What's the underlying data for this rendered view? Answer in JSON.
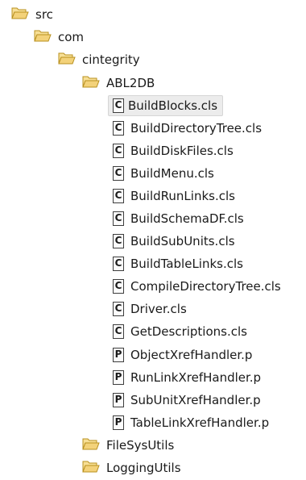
{
  "tree": {
    "src": "src",
    "com": "com",
    "cintegrity": "cintegrity",
    "abl2db": "ABL2DB",
    "files": [
      {
        "name": "BuildBlocks.cls",
        "type": "C"
      },
      {
        "name": "BuildDirectoryTree.cls",
        "type": "C"
      },
      {
        "name": "BuildDiskFiles.cls",
        "type": "C"
      },
      {
        "name": "BuildMenu.cls",
        "type": "C"
      },
      {
        "name": "BuildRunLinks.cls",
        "type": "C"
      },
      {
        "name": "BuildSchemaDF.cls",
        "type": "C"
      },
      {
        "name": "BuildSubUnits.cls",
        "type": "C"
      },
      {
        "name": "BuildTableLinks.cls",
        "type": "C"
      },
      {
        "name": "CompileDirectoryTree.cls",
        "type": "C"
      },
      {
        "name": "Driver.cls",
        "type": "C"
      },
      {
        "name": "GetDescriptions.cls",
        "type": "C"
      },
      {
        "name": "ObjectXrefHandler.p",
        "type": "P"
      },
      {
        "name": "RunLinkXrefHandler.p",
        "type": "P"
      },
      {
        "name": "SubUnitXrefHandler.p",
        "type": "P"
      },
      {
        "name": "TableLinkXrefHandler.p",
        "type": "P"
      }
    ],
    "filesysutils": "FileSysUtils",
    "loggingutils": "LoggingUtils",
    "selected_file": "BuildBlocks.cls"
  },
  "icons": {
    "folder": "open-folder-icon",
    "class_file": "class-file-icon",
    "procedure_file": "procedure-file-icon"
  },
  "colors": {
    "folder_fill": "#f3d27a",
    "folder_edge": "#b8901f",
    "selection": "#ececec"
  }
}
